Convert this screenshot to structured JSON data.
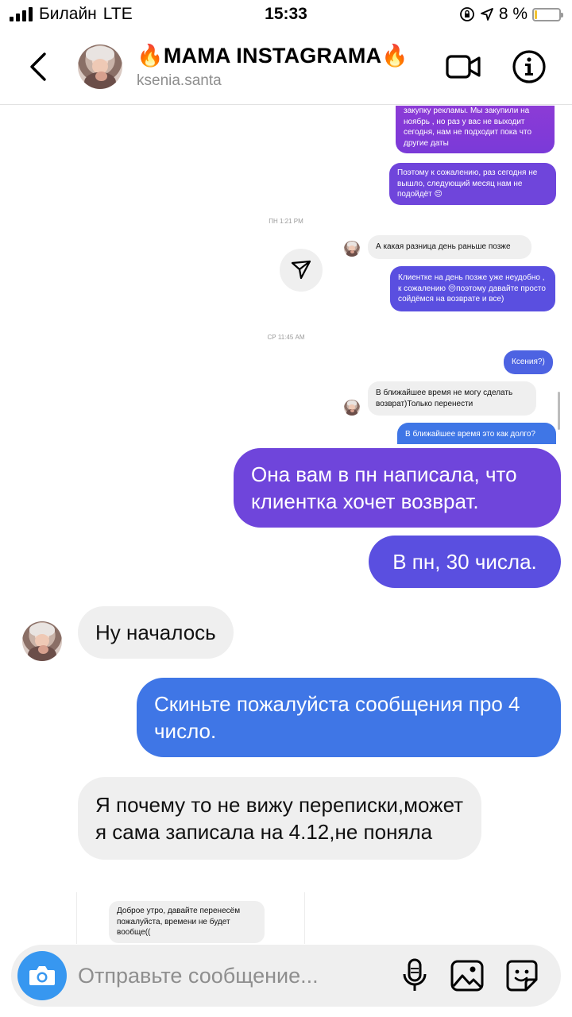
{
  "status_bar": {
    "carrier": "Билайн",
    "network": "LTE",
    "time": "15:33",
    "battery": "8 %",
    "battery_level": 0.08
  },
  "header": {
    "title": "🔥MAMA INSTAGRAMA🔥",
    "username": "ksenia.santa"
  },
  "colors": {
    "accent_blue": "#3797f0",
    "bubble_in": "#efefef",
    "bubble_purple": "#8e3bd6",
    "bubble_blue": "#3f76e6"
  },
  "screenshot_messages": [
    {
      "direction": "out",
      "text": "закупку рекламы. Мы закупили на ноябрь , но раз у вас не выходит сегодня, нам не подходит пока что другие даты"
    },
    {
      "direction": "out",
      "text": "Поэтому к сожалению, раз сегодня не вышло, следующий месяц нам не подойдёт 😔"
    },
    {
      "type": "timestamp",
      "text": "ПН 1:21 PM"
    },
    {
      "direction": "in",
      "text": "А какая разница день раньше позже"
    },
    {
      "direction": "out",
      "text": "Клиентке на день позже уже неудобно , к сожалению 😔поэтому давайте просто сойдёмся на возврате и все)"
    },
    {
      "type": "timestamp",
      "text": "СР 11:45 AM"
    },
    {
      "direction": "out",
      "text": "Ксения?)"
    },
    {
      "direction": "in",
      "text": "В ближайшее время не могу сделать возврат)Только перенести"
    },
    {
      "direction": "out",
      "text": "В ближайшее время это как долго?"
    }
  ],
  "messages": [
    {
      "direction": "out",
      "text": "Она вам в пн написала, что клиентка хочет возврат."
    },
    {
      "direction": "out",
      "text": "В пн, 30 числа."
    },
    {
      "direction": "in",
      "text": "Ну началось"
    },
    {
      "direction": "out",
      "text": "Скиньте пожалуйста сообщения про 4 число."
    },
    {
      "direction": "in",
      "text": "Я почему то не вижу переписки,может я сама записала на 4.12,не поняла"
    }
  ],
  "embedded_screenshot": {
    "text": "Доброе утро, давайте перенесём пожалуйста, времени не будет вообще(("
  },
  "composer": {
    "placeholder": "Отправьте сообщение..."
  },
  "icons": [
    "back-arrow-icon",
    "video-camera-icon",
    "info-icon",
    "send-arrow-icon",
    "camera-icon",
    "microphone-icon",
    "gallery-icon",
    "sticker-icon"
  ]
}
